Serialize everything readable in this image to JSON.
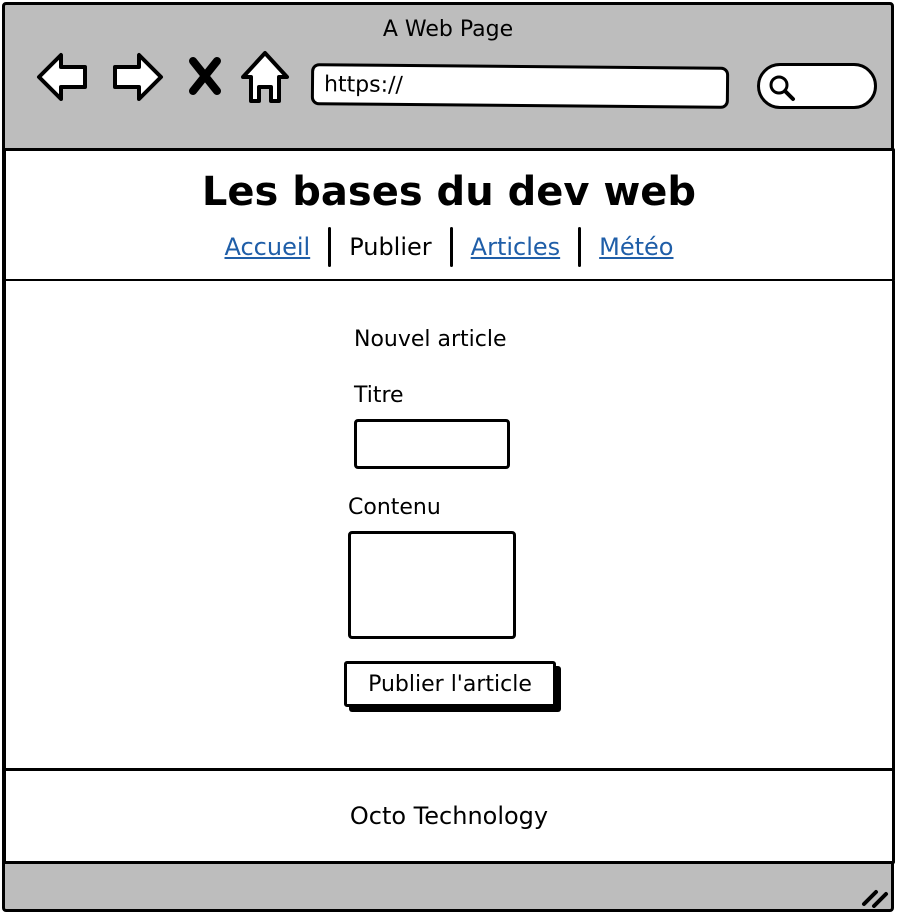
{
  "window": {
    "title": "A Web Page",
    "url": "https://"
  },
  "toolbar": {
    "back_icon": "back-arrow-icon",
    "forward_icon": "forward-arrow-icon",
    "stop_icon": "close-icon",
    "home_icon": "home-icon",
    "search_icon": "search-icon"
  },
  "header": {
    "title": "Les bases du dev web",
    "nav": {
      "accueil": "Accueil",
      "publier": "Publier",
      "articles": "Articles",
      "meteo": "Météo"
    }
  },
  "form": {
    "heading": "Nouvel article",
    "title_label": "Titre",
    "title_value": "",
    "content_label": "Contenu",
    "content_value": "",
    "submit_label": "Publier l'article"
  },
  "footer": {
    "text": "Octo Technology"
  },
  "colors": {
    "chrome": "#bdbdbd",
    "link": "#1f5ea8"
  }
}
